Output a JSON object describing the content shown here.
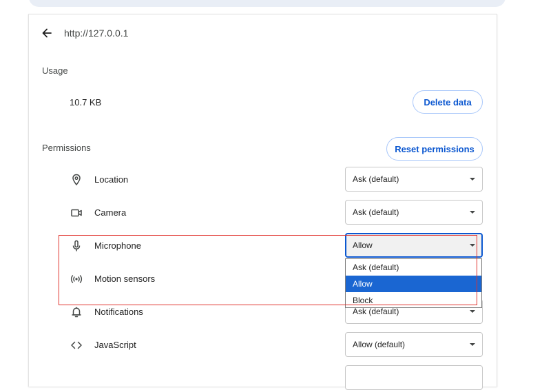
{
  "header": {
    "url": "http://127.0.0.1"
  },
  "usage": {
    "title": "Usage",
    "value": "10.7 KB",
    "delete_label": "Delete data"
  },
  "permissions": {
    "title": "Permissions",
    "reset_label": "Reset permissions",
    "items": [
      {
        "label": "Location",
        "icon": "location-pin-icon",
        "value": "Ask (default)"
      },
      {
        "label": "Camera",
        "icon": "camera-icon",
        "value": "Ask (default)"
      },
      {
        "label": "Microphone",
        "icon": "microphone-icon",
        "value": "Allow"
      },
      {
        "label": "Motion sensors",
        "icon": "motion-sensors-icon",
        "value": ""
      },
      {
        "label": "Notifications",
        "icon": "bell-icon",
        "value": "Ask (default)"
      },
      {
        "label": "JavaScript",
        "icon": "code-icon",
        "value": "Allow (default)"
      }
    ]
  },
  "dropdown": {
    "options": [
      "Ask (default)",
      "Allow",
      "Block"
    ],
    "selected": "Allow"
  },
  "colors": {
    "accent": "#0b57d0",
    "selected_option_bg": "#1a66d2",
    "annotation": "#e0312b"
  }
}
